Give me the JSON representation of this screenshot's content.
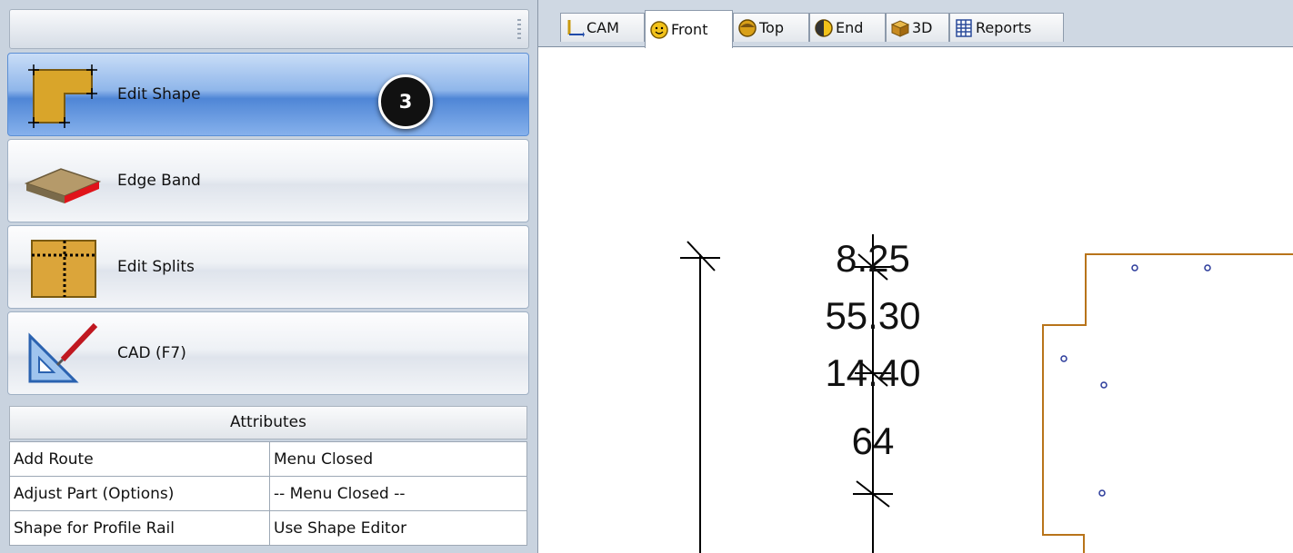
{
  "left_panel": {
    "commands": [
      {
        "label": "Edit Shape",
        "icon": "edit-shape-icon",
        "active": true
      },
      {
        "label": "Edge Band",
        "icon": "edge-band-icon",
        "active": false
      },
      {
        "label": "Edit Splits",
        "icon": "edit-splits-icon",
        "active": false
      },
      {
        "label": "CAD (F7)",
        "icon": "cad-icon",
        "active": false
      }
    ],
    "step_badge": "3",
    "attributes": {
      "header": "Attributes",
      "rows": [
        {
          "key": "Add Route",
          "value": "Menu Closed"
        },
        {
          "key": "Adjust Part (Options)",
          "value": "-- Menu Closed --"
        },
        {
          "key": "Shape for Profile Rail",
          "value": "Use Shape Editor"
        }
      ]
    }
  },
  "tabs": [
    {
      "label": "CAM",
      "icon": "cam-axes-icon",
      "active": false
    },
    {
      "label": "Front",
      "icon": "front-face-icon",
      "active": true
    },
    {
      "label": "Top",
      "icon": "top-face-icon",
      "active": false
    },
    {
      "label": "End",
      "icon": "end-face-icon",
      "active": false
    },
    {
      "label": "3D",
      "icon": "3d-box-icon",
      "active": false
    },
    {
      "label": "Reports",
      "icon": "reports-icon",
      "active": false
    }
  ],
  "drawing": {
    "dimensions": [
      "8.25",
      "55.30",
      "14.40",
      "64"
    ],
    "colors": {
      "outline": "#b8741a",
      "holes": "#2a3a9a",
      "lines": "#000000"
    }
  }
}
